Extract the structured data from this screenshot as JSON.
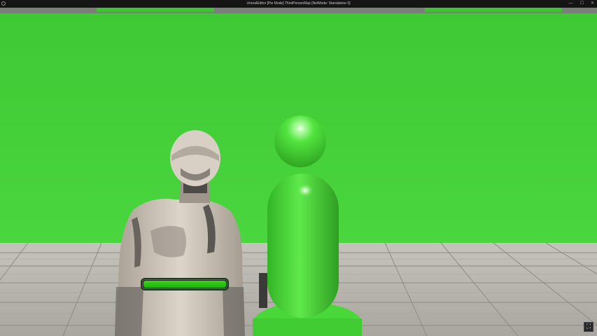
{
  "window": {
    "title": "UnrealEditor [Pie Mode] ThirdPersonMap [NetMode: Standalone 0]"
  },
  "icons": {
    "app_logo": "unreal-logo-icon",
    "minimize": "minimize-icon",
    "maximize": "maximize-icon",
    "close": "close-icon",
    "corner": "viewport-options-icon"
  },
  "window_controls": {
    "minimize": "—",
    "maximize": "☐",
    "close": "✕"
  },
  "hud": {
    "health_fraction": 1.0,
    "health_color": "#2fc61a"
  },
  "corner_icon_glyph": "⛶",
  "colors": {
    "wall_green": "#45d13a",
    "floor_grey": "#b9b5ae",
    "pillar_green": "#4fe040",
    "mannequin": "#cfc6bb"
  }
}
